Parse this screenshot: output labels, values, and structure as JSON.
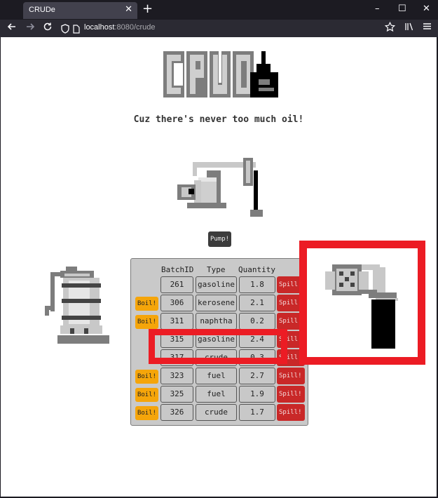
{
  "browser": {
    "tab_title": "CRUDe",
    "tab_close": "✕",
    "new_tab": "+",
    "url_host": "localhost",
    "url_rest": ":8080/crude",
    "window_controls": [
      "–",
      "☐",
      "✕"
    ]
  },
  "page": {
    "logo_text": "CRUDe",
    "tagline": "Cuz there's never too much oil!",
    "pump_button": "Pump!",
    "table": {
      "headers": [
        "BatchID",
        "Type",
        "Quantity"
      ],
      "rows": [
        {
          "id": "261",
          "type": "gasoline",
          "qty": "1.8",
          "boil": "",
          "spill": "Spill!"
        },
        {
          "id": "306",
          "type": "kerosene",
          "qty": "2.1",
          "boil": "Boil!",
          "spill": "Spill!"
        },
        {
          "id": "311",
          "type": "naphtha",
          "qty": "0.2",
          "boil": "Boil!",
          "spill": "Spill!"
        },
        {
          "id": "315",
          "type": "gasoline",
          "qty": "2.4",
          "boil": "",
          "spill": "Spill!"
        },
        {
          "id": "317",
          "type": "crude",
          "qty": "0.3",
          "boil": "",
          "spill": "Spill!"
        },
        {
          "id": "323",
          "type": "fuel",
          "qty": "2.7",
          "boil": "Boil!",
          "spill": "Spill!"
        },
        {
          "id": "325",
          "type": "fuel",
          "qty": "1.9",
          "boil": "Boil!",
          "spill": "Spill!"
        },
        {
          "id": "326",
          "type": "crude",
          "qty": "1.7",
          "boil": "Boil!",
          "spill": "Spill!"
        }
      ]
    }
  },
  "colors": {
    "boil": "#f5a50a",
    "spill": "#c92828",
    "highlight": "#ec1c24"
  },
  "icons": [
    "back-arrow-icon",
    "forward-arrow-icon",
    "reload-icon",
    "shield-icon",
    "page-icon",
    "star-icon",
    "library-icon",
    "menu-icon",
    "oil-drop-icon",
    "pumpjack-icon",
    "boiler-icon",
    "valve-icon"
  ]
}
